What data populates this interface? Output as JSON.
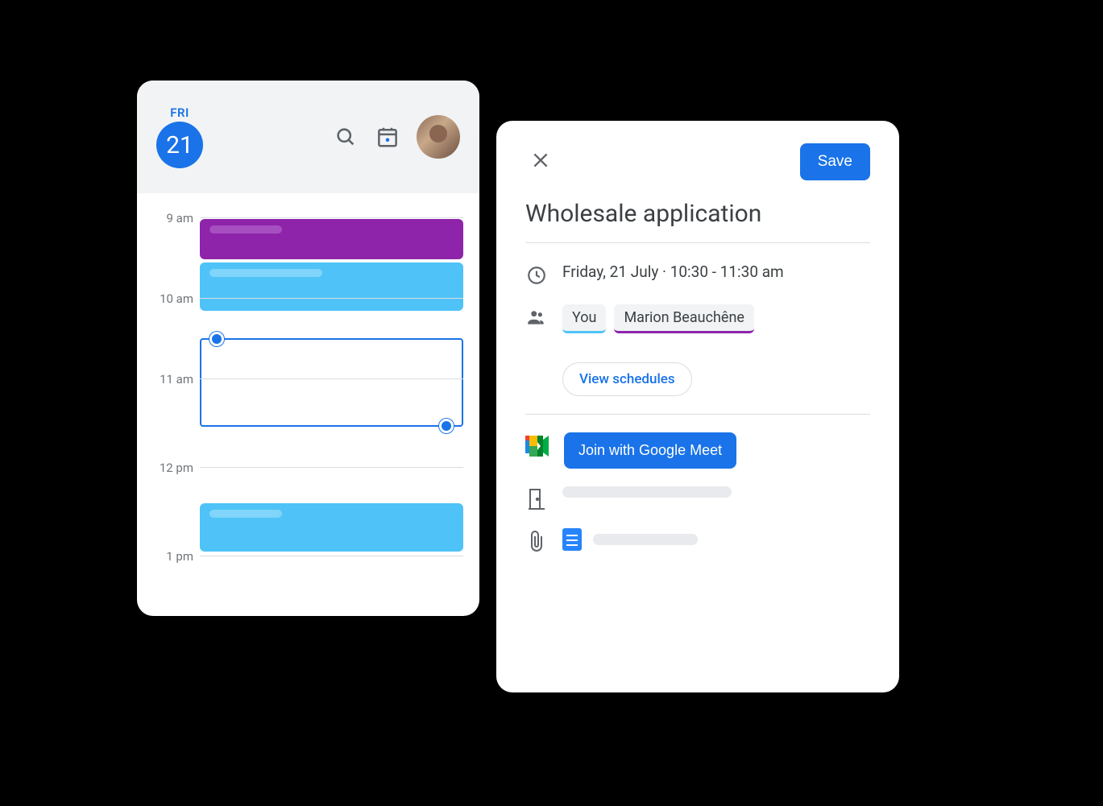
{
  "calendar": {
    "day_label": "FRI",
    "day_number": "21",
    "times": [
      "9 am",
      "10 am",
      "11 am",
      "12 pm",
      "1 pm"
    ]
  },
  "event": {
    "title": "Wholesale application",
    "date_line": "Friday, 21 July  ·  10:30 - 11:30 am",
    "attendees": {
      "you": "You",
      "other": "Marion Beauchêne"
    },
    "view_schedules": "View schedules",
    "join_meet": "Join with Google Meet",
    "save": "Save"
  }
}
